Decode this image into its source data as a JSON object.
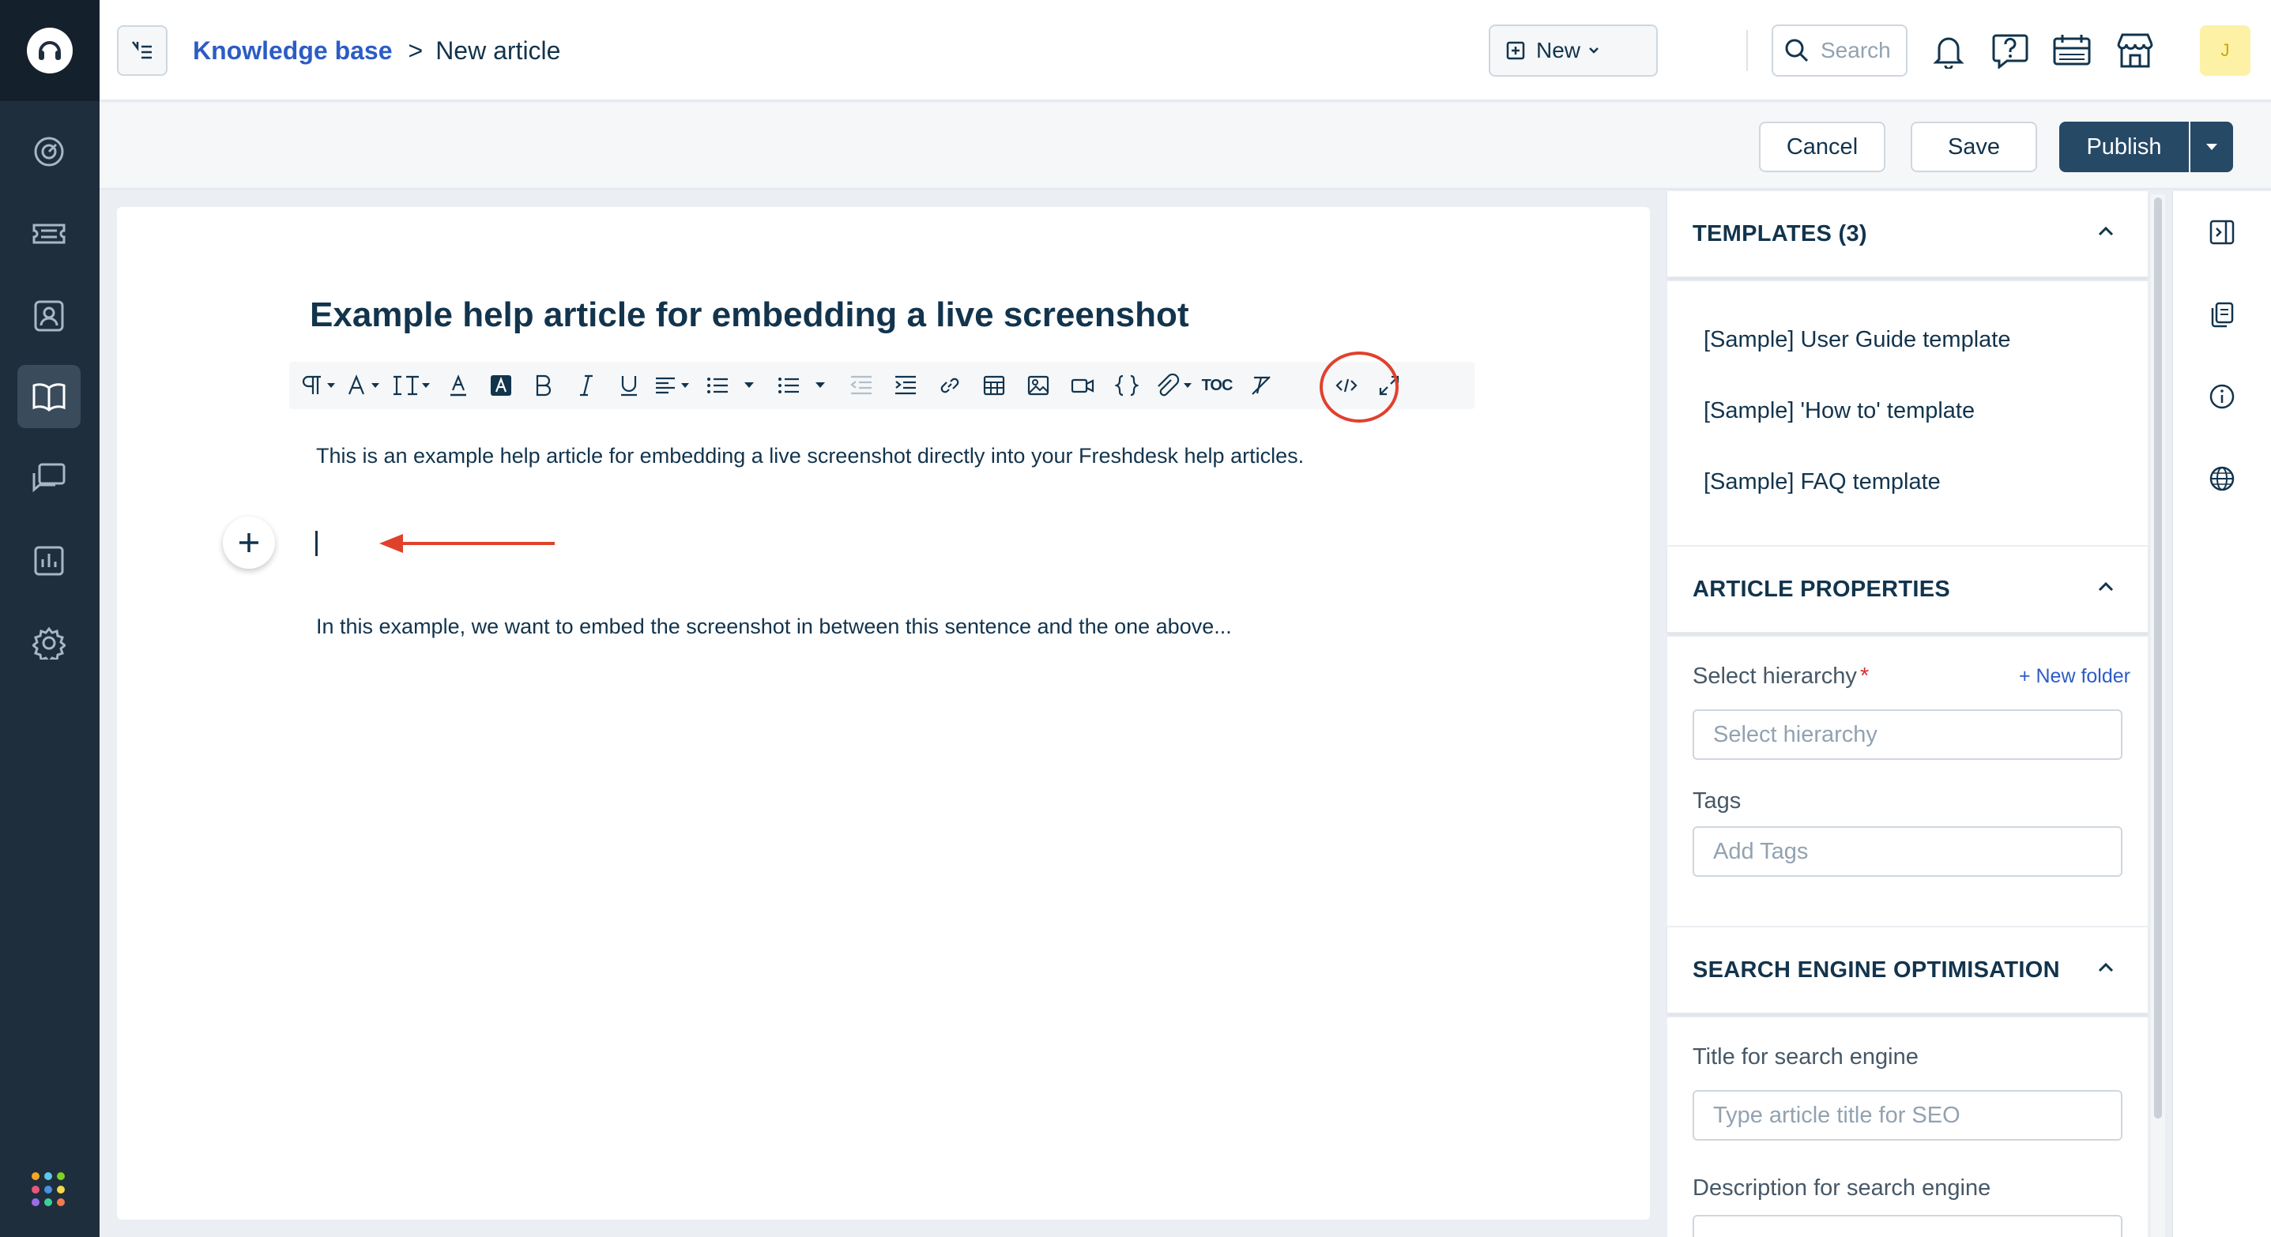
{
  "app": {
    "brand_colors": {
      "rail": "#1f2e3d",
      "primary": "#264966",
      "link": "#2c5cc5",
      "annotation": "#e0412d"
    }
  },
  "header": {
    "breadcrumb": {
      "parent": "Knowledge base",
      "separator": ">",
      "current": "New article"
    },
    "new_button_label": "New",
    "search_placeholder": "Search",
    "avatar_initial": "J"
  },
  "actions": {
    "cancel_label": "Cancel",
    "save_label": "Save",
    "publish_label": "Publish"
  },
  "editor": {
    "title": "Example help article for embedding a live screenshot",
    "paragraph_1": "This is an example help article for embedding a live screenshot directly into your Freshdesk help articles.",
    "paragraph_2": "In this example, we want to embed the screenshot in between this sentence and the one above...",
    "toolbar_toc_label": "TOC"
  },
  "panel": {
    "templates": {
      "heading": "TEMPLATES (3)",
      "items": [
        "[Sample] User Guide template",
        "[Sample] 'How to' template",
        "[Sample] FAQ template"
      ]
    },
    "properties": {
      "heading": "ARTICLE PROPERTIES",
      "hierarchy_label": "Select hierarchy",
      "required_mark": "*",
      "new_folder_label": "+ New folder",
      "hierarchy_placeholder": "Select hierarchy",
      "tags_label": "Tags",
      "tags_placeholder": "Add Tags"
    },
    "seo": {
      "heading": "SEARCH ENGINE OPTIMISATION",
      "title_label": "Title for search engine",
      "title_placeholder": "Type article title for SEO",
      "description_label": "Description for search engine"
    }
  }
}
